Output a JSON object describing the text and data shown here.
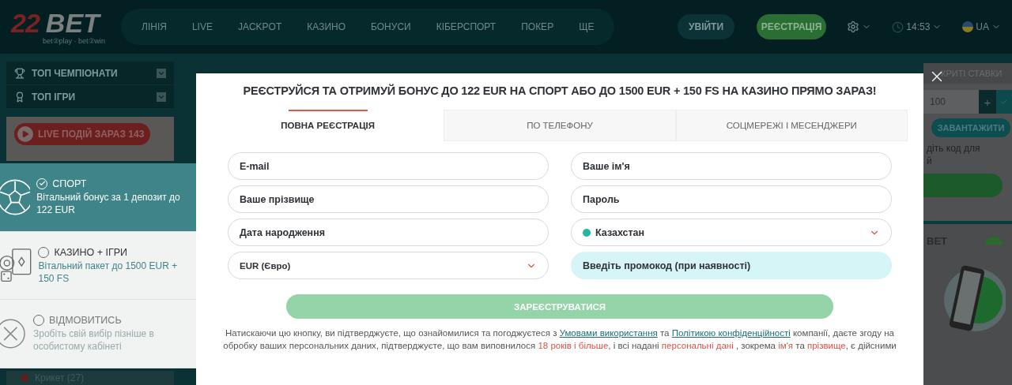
{
  "header": {
    "logo": {
      "digits": "22",
      "word": "BET",
      "tagline": "bet②play · bet②win"
    },
    "nav": [
      {
        "label": "ЛІНІЯ"
      },
      {
        "label": "LIVE"
      },
      {
        "label": "JACKPOT"
      },
      {
        "label": "КАЗИНО"
      },
      {
        "label": "БОНУСИ"
      },
      {
        "label": "КІБЕРСПОРТ"
      },
      {
        "label": "ПОКЕР"
      },
      {
        "label": "ЩЕ"
      }
    ],
    "login": "УВІЙТИ",
    "register": "РЕЄСТРАЦІЯ",
    "time": "14:53",
    "language": "UA"
  },
  "sidebar": {
    "sections": [
      {
        "kind": "trophy",
        "label": "ТОП ЧЕМПІОНАТИ"
      },
      {
        "kind": "medal",
        "label": "ТОП ІГРИ"
      }
    ],
    "live_button": "LIVE ПОДІЙ ЗАРАЗ 143",
    "bottom_item": "Крикет (27)"
  },
  "bonus_choice": [
    {
      "kind": "sport",
      "title": "СПОРТ",
      "description": "Вітальний бонус за 1 депозит до 122 EUR",
      "selected": true
    },
    {
      "kind": "casino",
      "title": "КАЗИНО + ІГРИ",
      "description": "Вітальний пакет до 1500 EUR + 150 FS",
      "selected": false
    },
    {
      "kind": "decline",
      "title": "ВІДМОВИТИСЬ",
      "description": "Зробіть свій вибір пізніше в особистому кабінеті",
      "selected": false
    }
  ],
  "coupon": {
    "tab_label": "КРИТІ СТАВКИ",
    "stake": "100",
    "plus": "+",
    "download": "ЗАВАНТАЖИТИ",
    "hint_lines": [
      "діть код для",
      "й"
    ],
    "app_title": "BET"
  },
  "modal": {
    "title": "РЕЄСТРУЙСЯ ТА ОТРИМУЙ БОНУС ДО 122 EUR НА СПОРТ АБО ДО 1500 EUR + 150 FS НА КАЗИНО ПРЯМО ЗАРАЗ!",
    "tabs": [
      {
        "label": "ПОВНА РЕЄСТРАЦІЯ",
        "selected": true
      },
      {
        "label": "ПО ТЕЛЕФОНУ",
        "selected": false
      },
      {
        "label": "СОЦМЕРЕЖІ І МЕСЕНДЖЕРИ",
        "selected": false
      }
    ],
    "fields": [
      {
        "kind": "text",
        "placeholder": "E-mail"
      },
      {
        "kind": "text",
        "placeholder": "Ваше ім'я"
      },
      {
        "kind": "text",
        "placeholder": "Ваше прізвище"
      },
      {
        "kind": "text",
        "placeholder": "Пароль"
      },
      {
        "kind": "text",
        "placeholder": "Дата народження"
      },
      {
        "kind": "country",
        "value": "Казахстан"
      },
      {
        "kind": "select",
        "value": "EUR (Євро)"
      },
      {
        "kind": "promo",
        "placeholder": "Введіть промокод (при наявності)"
      }
    ],
    "submit": "ЗАРЕЄСТРУВАТИСЯ",
    "legal": [
      {
        "kind": "plain",
        "text": "Натискаючи цю кнопку, ви підтверджуєте, що ознайомилися та погоджуєтеся з "
      },
      {
        "kind": "link",
        "text": "Умовами використання"
      },
      {
        "kind": "plain",
        "text": " та "
      },
      {
        "kind": "link",
        "text": "Політикою конфіденційності"
      },
      {
        "kind": "plain",
        "text": " компанії, даєте згоду на обробку ваших персональних даних, підтверджуєте, що вам виповнилося "
      },
      {
        "kind": "highlight",
        "text": "18 років і більше"
      },
      {
        "kind": "plain",
        "text": ", і всі надані "
      },
      {
        "kind": "highlight",
        "text": "персональні дані"
      },
      {
        "kind": "plain",
        "text": " , зокрема "
      },
      {
        "kind": "highlight",
        "text": "ім'я"
      },
      {
        "kind": "plain",
        "text": " та "
      },
      {
        "kind": "highlight",
        "text": "прізвище"
      },
      {
        "kind": "plain",
        "text": ", є дійсними"
      }
    ]
  }
}
